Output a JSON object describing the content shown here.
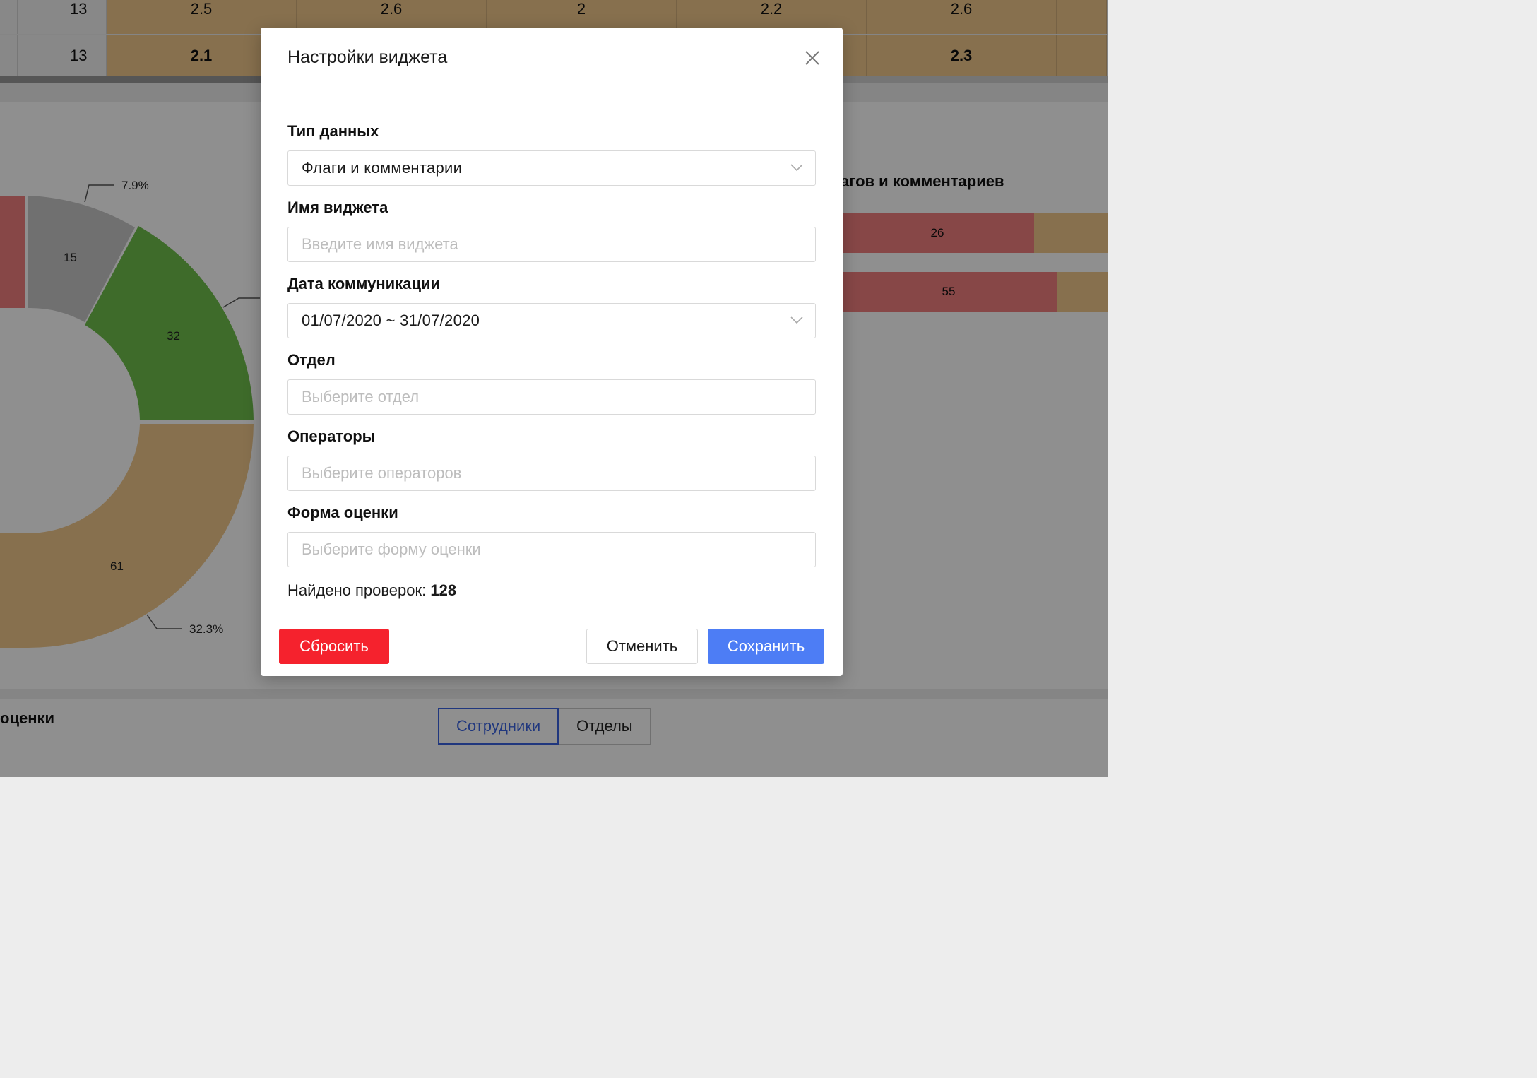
{
  "background": {
    "table": {
      "rows": [
        {
          "num": "13",
          "values": [
            "2.5",
            "2.6",
            "2",
            "2.2",
            "2.6"
          ],
          "bold": false
        },
        {
          "num": "13",
          "values": [
            "2.1",
            "",
            "",
            "",
            "2.3"
          ],
          "bold": true
        }
      ]
    },
    "donut": {
      "labels": {
        "slice_gray": "15",
        "slice_green": "32",
        "slice_orange": "61",
        "pct_gray": "7.9%",
        "pct_orange": "32.3%"
      }
    },
    "right_chart": {
      "title": "агов и комментариев",
      "bars": [
        {
          "value": "26"
        },
        {
          "value": "55"
        }
      ]
    },
    "bottom_section": {
      "title": "оценки",
      "tabs": [
        {
          "label": "Сотрудники",
          "active": true
        },
        {
          "label": "Отделы",
          "active": false
        }
      ]
    },
    "colors": {
      "orange": "#f0c88c",
      "green": "#6fbf4c",
      "gray": "#c8c8c8",
      "red": "#f07f7f"
    }
  },
  "modal": {
    "title": "Настройки виджета",
    "fields": {
      "data_type": {
        "label": "Тип данных",
        "value": "Флаги и комментарии"
      },
      "widget_name": {
        "label": "Имя виджета",
        "placeholder": "Введите имя виджета"
      },
      "comm_date": {
        "label": "Дата коммуникации",
        "value": "01/07/2020 ~ 31/07/2020"
      },
      "department": {
        "label": "Отдел",
        "placeholder": "Выберите отдел"
      },
      "operators": {
        "label": "Операторы",
        "placeholder": "Выберите операторов"
      },
      "eval_form": {
        "label": "Форма оценки",
        "placeholder": "Выберите форму оценки"
      }
    },
    "found": {
      "text": "Найдено проверок:",
      "count": "128"
    },
    "buttons": {
      "reset": "Сбросить",
      "cancel": "Отменить",
      "save": "Сохранить"
    },
    "colors": {
      "reset": "#f5222d",
      "save": "#4d7df5"
    }
  }
}
